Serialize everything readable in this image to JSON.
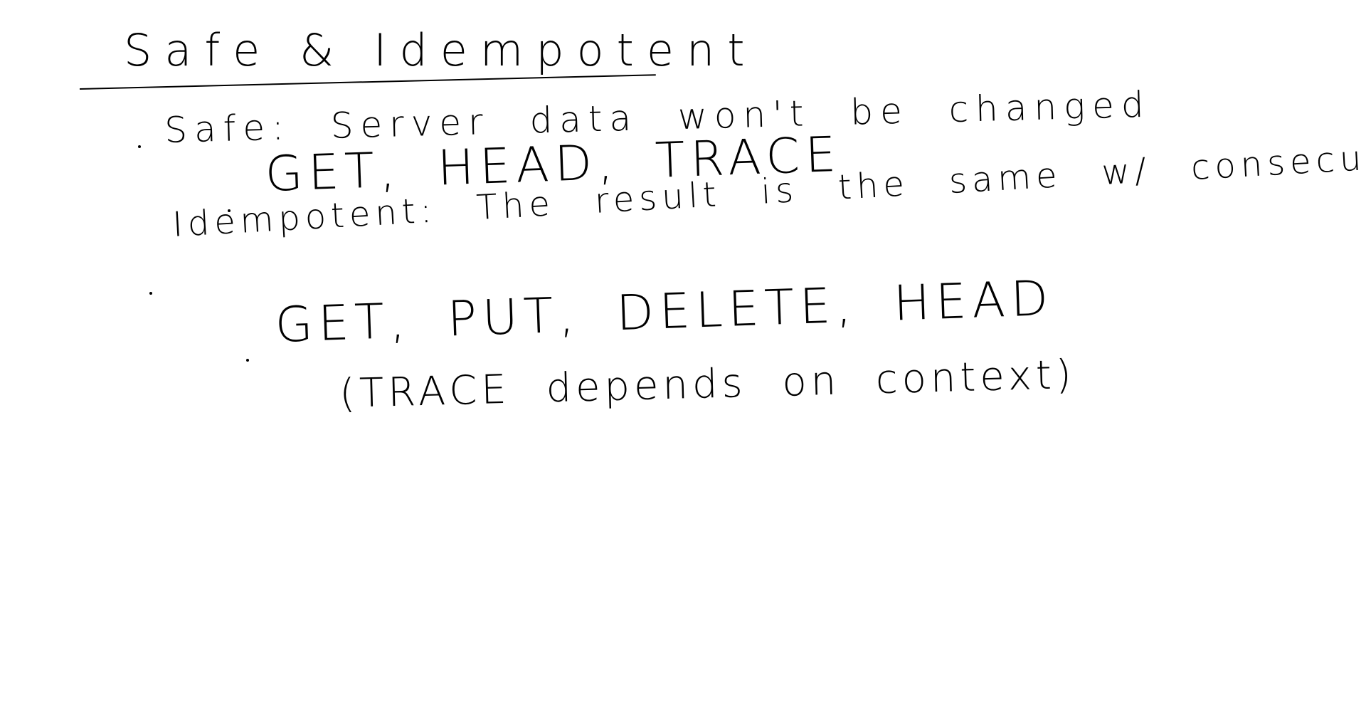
{
  "note": {
    "title": "Safe & Idempotent",
    "safe": {
      "definition": "Safe: Server data won't be changed",
      "methods": "GET, HEAD, TRACE"
    },
    "idempotent": {
      "definition": "Idempotent: The result is the same w/ consecutive use",
      "methods": "GET, PUT, DELETE, HEAD",
      "aside": "(TRACE depends on context)"
    }
  }
}
